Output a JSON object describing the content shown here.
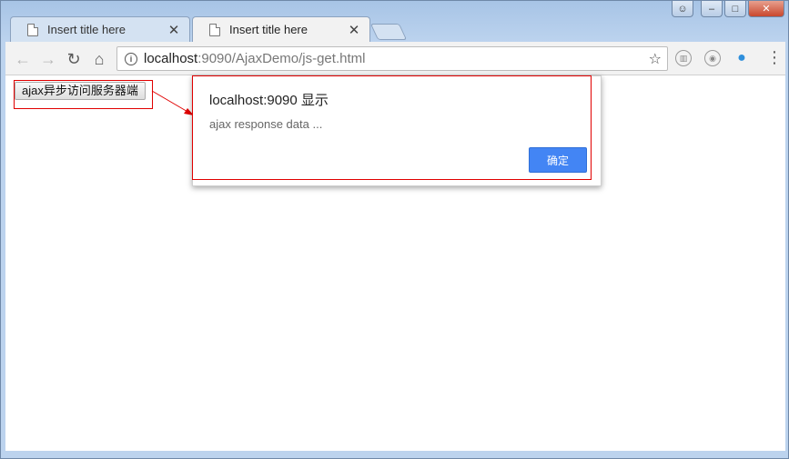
{
  "tabs": [
    {
      "title": "Insert title here",
      "active": false
    },
    {
      "title": "Insert title here",
      "active": true
    }
  ],
  "toolbar": {
    "url_host": "localhost",
    "url_path": ":9090/AjaxDemo/js-get.html"
  },
  "page": {
    "ajax_button_label": "ajax异步访问服务器端"
  },
  "dialog": {
    "title": "localhost:9090 显示",
    "message": "ajax response data ...",
    "ok_label": "确定"
  },
  "colors": {
    "accent": "#4385f4",
    "annotation": "#e00000"
  }
}
